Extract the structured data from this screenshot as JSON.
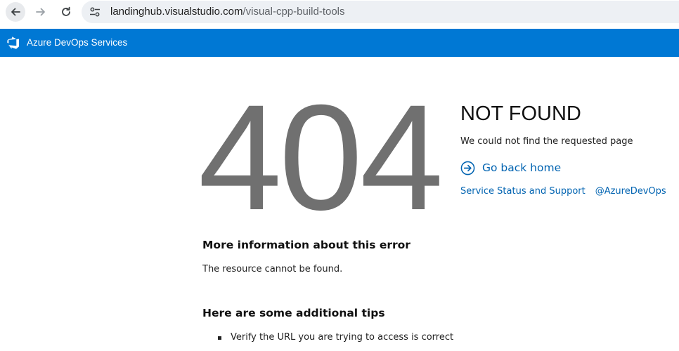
{
  "browser": {
    "url_host": "landinghub.visualstudio.com",
    "url_path": "/visual-cpp-build-tools",
    "icons": {
      "back": "arrow-left-icon",
      "forward": "arrow-right-icon",
      "reload": "reload-icon",
      "site_info": "tune-icon"
    }
  },
  "header": {
    "title": "Azure DevOps Services",
    "logo_icon": "azure-devops-logo",
    "bg_color": "#0078d4"
  },
  "error": {
    "code": "404",
    "title": "NOT FOUND",
    "subtitle": "We could not find the requested page",
    "home_link": "Go back home",
    "home_icon": "circle-arrow-right-icon",
    "status_link": "Service Status and Support",
    "twitter_link": "@AzureDevOps",
    "link_color": "#0063b1"
  },
  "more_info": {
    "heading": "More information about this error",
    "text": "The resource cannot be found."
  },
  "tips": {
    "heading": "Here are some additional tips",
    "items": [
      "Verify the URL you are trying to access is correct"
    ]
  }
}
